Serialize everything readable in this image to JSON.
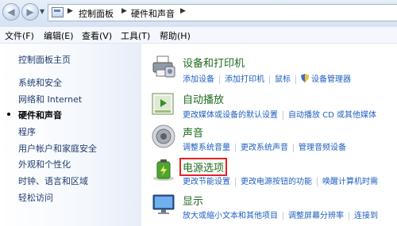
{
  "address_bar": {
    "breadcrumbs": [
      "控制面板",
      "硬件和声音"
    ]
  },
  "menu": [
    "文件(F)",
    "编辑(E)",
    "查看(V)",
    "工具(T)",
    "帮助(H)"
  ],
  "sidebar": {
    "items": [
      {
        "label": "控制面板主页",
        "current": false
      },
      {
        "label": "系统和安全",
        "current": false
      },
      {
        "label": "网络和 Internet",
        "current": false
      },
      {
        "label": "硬件和声音",
        "current": true
      },
      {
        "label": "程序",
        "current": false
      },
      {
        "label": "用户帐户和家庭安全",
        "current": false
      },
      {
        "label": "外观和个性化",
        "current": false
      },
      {
        "label": "时钟、语言和区域",
        "current": false
      },
      {
        "label": "轻松访问",
        "current": false
      }
    ]
  },
  "categories": [
    {
      "icon": "printer-icon",
      "title": "设备和打印机",
      "highlighted": false,
      "links": [
        "添加设备",
        "添加打印机",
        "鼠标",
        "设备管理器"
      ]
    },
    {
      "icon": "autoplay-icon",
      "title": "自动播放",
      "highlighted": false,
      "links": [
        "更改媒体或设备的默认设置",
        "自动播放 CD 或其他媒体"
      ]
    },
    {
      "icon": "speaker-icon",
      "title": "声音",
      "highlighted": false,
      "links": [
        "调整系统音量",
        "更改系统声音",
        "管理音频设备"
      ]
    },
    {
      "icon": "battery-icon",
      "title": "电源选项",
      "highlighted": true,
      "links": [
        "更改节能设置",
        "更改电源按钮的功能",
        "唤醒计算机时需"
      ]
    },
    {
      "icon": "display-icon",
      "title": "显示",
      "highlighted": false,
      "links": [
        "放大或缩小文本和其他项目",
        "调整屏幕分辨率",
        "连接到"
      ]
    }
  ],
  "colors": {
    "link": "#1d5fbf",
    "category_title": "#1e6a1e",
    "highlight_border": "#e02323"
  }
}
